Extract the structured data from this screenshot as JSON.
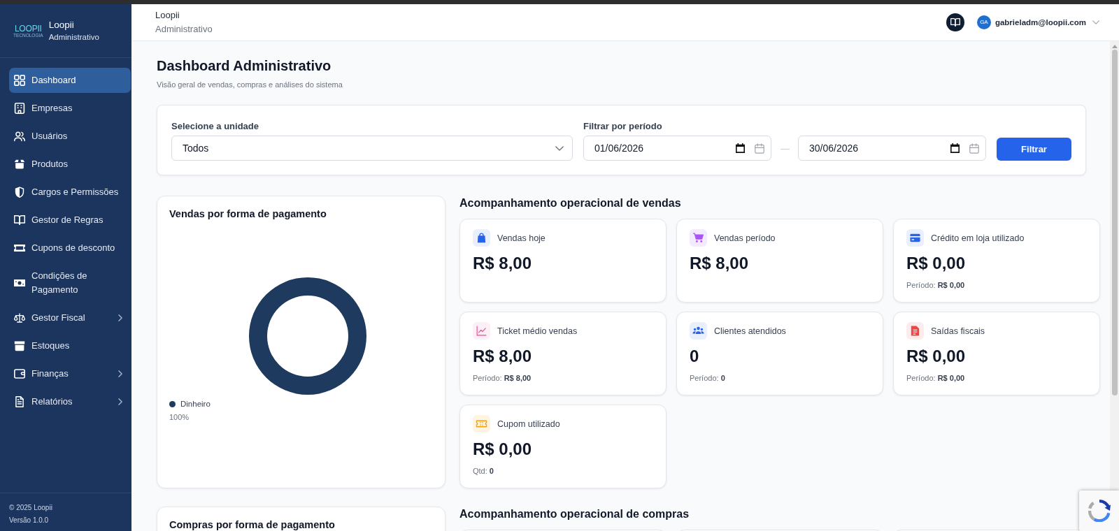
{
  "sidebar": {
    "logo": {
      "wordmark": "LOOPII",
      "tagline": "TECNOLOGIA"
    },
    "brand": {
      "name": "Loopii",
      "subtitle": "Administrativo"
    },
    "items": [
      {
        "label": "Dashboard",
        "selected": true,
        "submenu": false
      },
      {
        "label": "Empresas",
        "selected": false,
        "submenu": false
      },
      {
        "label": "Usuários",
        "selected": false,
        "submenu": false
      },
      {
        "label": "Produtos",
        "selected": false,
        "submenu": false
      },
      {
        "label": "Cargos e Permissões",
        "selected": false,
        "submenu": false
      },
      {
        "label": "Gestor de Regras",
        "selected": false,
        "submenu": false
      },
      {
        "label": "Cupons de desconto",
        "selected": false,
        "submenu": false
      },
      {
        "label": "Condições de Pagamento",
        "selected": false,
        "submenu": false
      },
      {
        "label": "Gestor Fiscal",
        "selected": false,
        "submenu": true
      },
      {
        "label": "Estoques",
        "selected": false,
        "submenu": false
      },
      {
        "label": "Finanças",
        "selected": false,
        "submenu": true
      },
      {
        "label": "Relatórios",
        "selected": false,
        "submenu": true
      }
    ],
    "footer": {
      "copyright": "© 2025 Loopii",
      "version": "Versão 1.0.0"
    }
  },
  "header": {
    "title": "Loopii",
    "subtitle": "Administrativo",
    "user": {
      "initials": "GA",
      "email": "gabrieladm@loopii.com"
    }
  },
  "page": {
    "title": "Dashboard Administrativo",
    "subtitle": "Visão geral de vendas, compras e análises do sistema"
  },
  "filters": {
    "unit": {
      "label": "Selecione a unidade",
      "value": "Todos"
    },
    "period": {
      "label": "Filtrar por período",
      "start": "01/06/2026",
      "separator": "—",
      "end": "30/06/2026"
    },
    "button": "Filtrar"
  },
  "vendas": {
    "chart_data": {
      "type": "donut",
      "title": "Vendas por forma de pagamento",
      "categories": [
        "Dinheiro"
      ],
      "series": [
        {
          "color": "#1e3a5f",
          "values": [
            100
          ]
        }
      ],
      "value_labels": [
        "100%"
      ]
    },
    "title": "Acompanhamento operacional de vendas",
    "cards": [
      {
        "label": "Vendas hoje",
        "value": "R$ 8,00"
      },
      {
        "label": "Vendas período",
        "value": "R$ 8,00"
      },
      {
        "label": "Crédito em loja utilizado",
        "value": "R$ 0,00",
        "detail": "Período: **R$ 0,00**"
      },
      {
        "label": "Ticket médio vendas",
        "value": "R$ 8,00",
        "detail": "Período: **R$ 8,00**"
      },
      {
        "label": "Clientes atendidos",
        "value": "0",
        "detail": "Período: **0**"
      },
      {
        "label": "Saídas fiscais",
        "value": "R$ 0,00",
        "detail": "Período: **R$ 0,00**"
      },
      {
        "label": "Cupom utilizado",
        "value": "R$ 0,00",
        "detail": "Qtd: **0**"
      }
    ]
  },
  "compras": {
    "chart_title": "Compras por forma de pagamento",
    "title": "Acompanhamento operacional de compras"
  }
}
